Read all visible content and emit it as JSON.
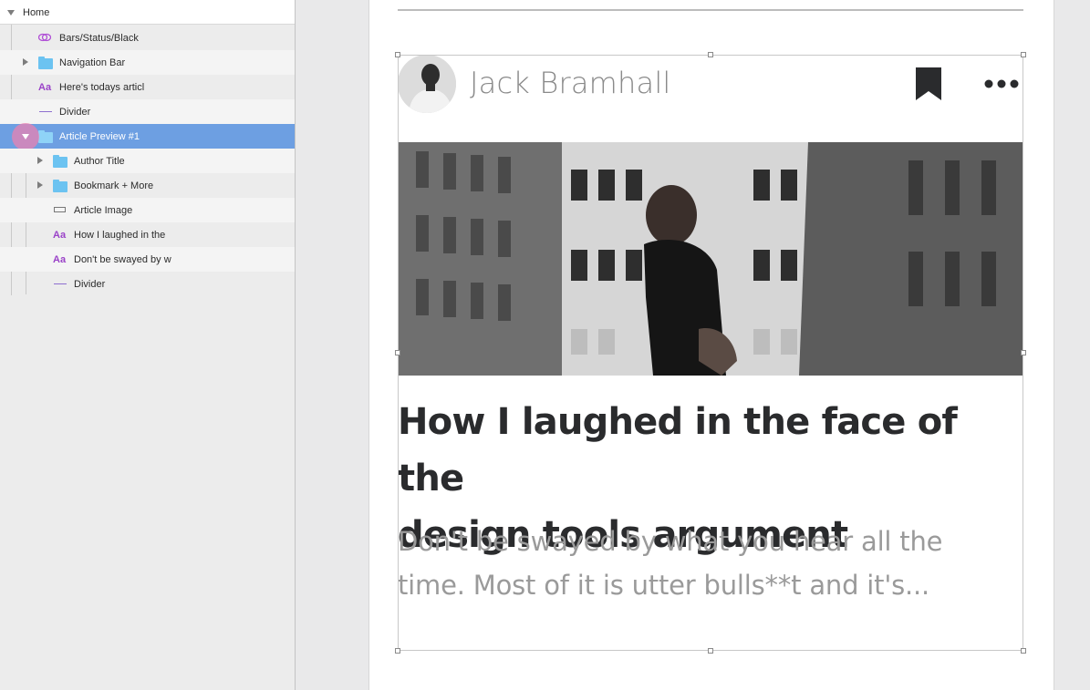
{
  "layers": {
    "items": [
      {
        "label": "Home",
        "icon": "disclosure-open"
      },
      {
        "label": "Bars/Status/Black",
        "icon": "symbol-icon"
      },
      {
        "label": "Navigation Bar",
        "icon": "folder-icon"
      },
      {
        "label": "Here's todays articl",
        "icon": "text-icon",
        "glyph": "Aa"
      },
      {
        "label": "Divider",
        "icon": "line-icon"
      },
      {
        "label": "Article Preview #1",
        "icon": "folder-icon",
        "selected": true
      },
      {
        "label": "Author Title",
        "icon": "folder-icon"
      },
      {
        "label": "Bookmark + More",
        "icon": "folder-icon"
      },
      {
        "label": "Article Image",
        "icon": "rectangle-icon"
      },
      {
        "label": "How I laughed in the",
        "icon": "text-icon",
        "glyph": "Aa"
      },
      {
        "label": "Don't be swayed by w",
        "icon": "text-icon",
        "glyph": "Aa"
      },
      {
        "label": "Divider",
        "icon": "line-icon"
      }
    ]
  },
  "article": {
    "author_name": "Jack Bramhall",
    "headline_line1": "How I laughed in the face of the",
    "headline_line2": "design tools argument",
    "summary_line1": "Don't be swayed by what you hear all the",
    "summary_line2": "time. Most of it is utter bulls**t and it's..."
  },
  "colors": {
    "selection": "#6d9fe2",
    "folder": "#6cc3f1",
    "text_layer": "#9a42c8",
    "headline": "#2a2b2d",
    "summary": "#9a9a9a"
  }
}
